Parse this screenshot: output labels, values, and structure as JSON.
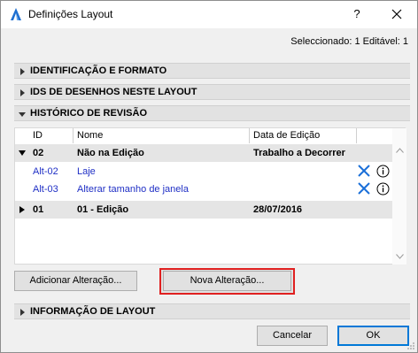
{
  "window": {
    "title": "Definições Layout",
    "help_label": "?",
    "selection_info": "Seleccionado: 1 Editável: 1"
  },
  "sections": {
    "identification": "IDENTIFICAÇÃO E FORMATO",
    "drawing_ids": "IDS DE DESENHOS NESTE LAYOUT",
    "revision_history": "HISTÓRICO DE REVISÃO",
    "layout_info": "INFORMAÇÃO DE LAYOUT"
  },
  "table": {
    "columns": [
      "ID",
      "Nome",
      "Data de Edição"
    ],
    "rows": [
      {
        "id": "02",
        "name": "Não na Edição",
        "date": "Trabalho a Decorrer",
        "kind": "group",
        "expanded": true
      },
      {
        "id": "Alt-02",
        "name": "Laje",
        "date": "",
        "kind": "change"
      },
      {
        "id": "Alt-03",
        "name": "Alterar tamanho de janela",
        "date": "",
        "kind": "change"
      },
      {
        "id": "01",
        "name": "01 - Edição",
        "date": "28/07/2016",
        "kind": "group",
        "expanded": false
      }
    ]
  },
  "buttons": {
    "add_change": "Adicionar Alteração...",
    "new_change": "Nova Alteração...",
    "cancel": "Cancelar",
    "ok": "OK"
  },
  "colors": {
    "link_blue": "#1f2fc5",
    "icon_blue": "#1a6fd8",
    "highlight_red": "#e02020"
  },
  "icons": {
    "app": "archicad-icon",
    "delete": "x-icon",
    "info": "info-icon"
  }
}
